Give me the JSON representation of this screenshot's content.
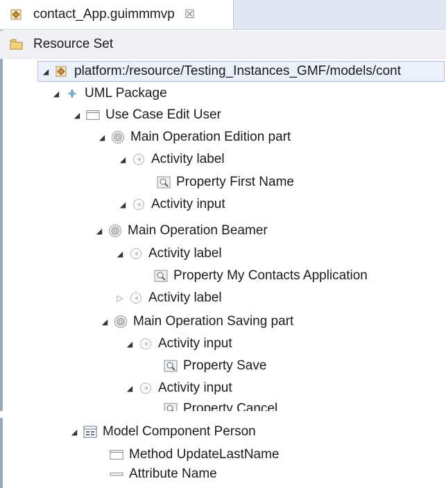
{
  "tab": {
    "title": "contact_App.guimmmvp",
    "close_glyph": "☒",
    "icon": "gmf-model-icon"
  },
  "resource_set": {
    "label": "Resource Set",
    "icon": "folder-icon"
  },
  "tree": [
    {
      "id": "platform",
      "label": "platform:/resource/Testing_Instances_GMF/models/cont",
      "icon": "gmf-model-icon",
      "expanded": true,
      "selected": true
    },
    {
      "id": "uml-package",
      "label": "UML Package",
      "icon": "package-icon",
      "expanded": true
    },
    {
      "id": "use-case",
      "label": "Use Case Edit User",
      "icon": "window-icon",
      "expanded": true
    },
    {
      "id": "main-op-edition",
      "label": "Main Operation Edition part",
      "icon": "gear-icon",
      "expanded": true
    },
    {
      "id": "act-label-1",
      "label": "Activity label",
      "icon": "activity-icon",
      "expanded": true
    },
    {
      "id": "prop-first-name",
      "label": "Property First Name",
      "icon": "property-icon"
    },
    {
      "id": "act-input-1",
      "label": "Activity input",
      "icon": "activity-icon",
      "expanded": true
    },
    {
      "id": "main-op-beamer",
      "label": "Main Operation Beamer",
      "icon": "gear-icon",
      "expanded": true
    },
    {
      "id": "act-label-2",
      "label": "Activity label",
      "icon": "activity-icon",
      "expanded": true
    },
    {
      "id": "prop-my-contacts",
      "label": "Property My Contacts Application",
      "icon": "property-icon"
    },
    {
      "id": "act-label-3",
      "label": "Activity label",
      "icon": "activity-icon",
      "expanded": false
    },
    {
      "id": "main-op-saving",
      "label": "Main Operation Saving part",
      "icon": "gear-icon",
      "expanded": true
    },
    {
      "id": "act-input-2",
      "label": "Activity input",
      "icon": "activity-icon",
      "expanded": true
    },
    {
      "id": "prop-save",
      "label": "Property Save",
      "icon": "property-icon"
    },
    {
      "id": "act-input-3",
      "label": "Activity input",
      "icon": "activity-icon",
      "expanded": true
    },
    {
      "id": "prop-cancel",
      "label": "Property Cancel",
      "icon": "property-icon"
    },
    {
      "id": "model-component",
      "label": "Model Component Person",
      "icon": "table-icon",
      "expanded": true
    },
    {
      "id": "method-update",
      "label": "Method UpdateLastName",
      "icon": "window-icon"
    },
    {
      "id": "attribute-name",
      "label": "Attribute Name",
      "icon": "dash-icon"
    }
  ]
}
